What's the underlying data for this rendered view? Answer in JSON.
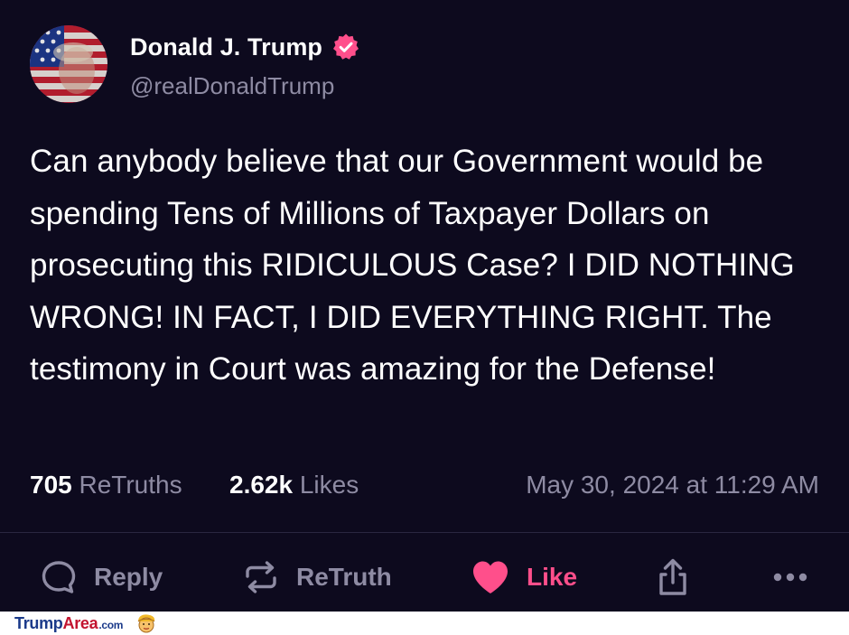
{
  "post": {
    "author": {
      "display_name": "Donald J. Trump",
      "handle": "@realDonaldTrump",
      "verified": true,
      "avatar_icon": "flag-portrait-avatar"
    },
    "text": "Can anybody believe that our Government would be spending Tens of Millions of Taxpayer Dollars on prosecuting this RIDICULOUS Case? I DID NOTHING WRONG! IN FACT, I DID EVERYTHING RIGHT. The testimony in Court was amazing for the Defense!",
    "stats": {
      "retruths_count": "705",
      "retruths_label": "ReTruths",
      "likes_count": "2.62k",
      "likes_label": "Likes"
    },
    "timestamp": "May 30, 2024 at 11:29 AM"
  },
  "actions": {
    "reply_label": "Reply",
    "retruth_label": "ReTruth",
    "like_label": "Like"
  },
  "footer": {
    "brand_part1": "Trump",
    "brand_part2": "Area",
    "brand_part3": ".com"
  },
  "colors": {
    "background": "#0d0a1e",
    "muted_text": "#8e8ba3",
    "like_accent": "#ff4f8b",
    "verified_badge": "#ff4f8b"
  }
}
